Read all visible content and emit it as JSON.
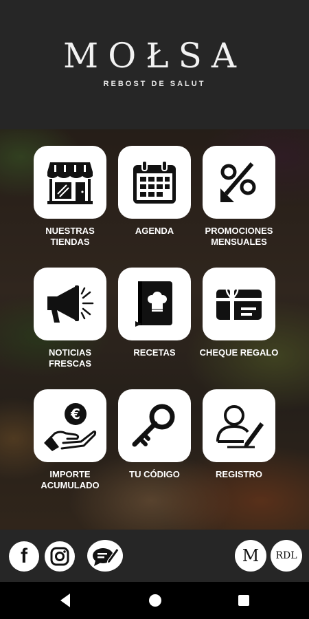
{
  "header": {
    "logo": "MOŁSA",
    "subtitle": "REBOST DE SALUT"
  },
  "menu": [
    {
      "label_1": "NUESTRAS",
      "label_2": "TIENDAS",
      "icon": "store-icon"
    },
    {
      "label_1": "AGENDA",
      "label_2": "",
      "icon": "calendar-icon"
    },
    {
      "label_1": "PROMOCIONES",
      "label_2": "MENSUALES",
      "icon": "percent-icon"
    },
    {
      "label_1": "NOTICIAS",
      "label_2": "FRESCAS",
      "icon": "megaphone-icon"
    },
    {
      "label_1": "RECETAS",
      "label_2": "",
      "icon": "recipe-book-icon"
    },
    {
      "label_1": "CHEQUE REGALO",
      "label_2": "",
      "icon": "gift-card-icon"
    },
    {
      "label_1": "IMPORTE",
      "label_2": "ACUMULADO",
      "icon": "euro-hand-icon"
    },
    {
      "label_1": "TU CÓDIGO",
      "label_2": "",
      "icon": "key-icon"
    },
    {
      "label_1": "REGISTRO",
      "label_2": "",
      "icon": "register-user-icon"
    }
  ],
  "footer": {
    "facebook": "f",
    "brand_badge_1": "M",
    "brand_badge_2": "RDL"
  },
  "colors": {
    "header_bg": "#262626",
    "tile_bg": "#ffffff",
    "label_text": "#ffffff",
    "nav_bg": "#000000"
  }
}
